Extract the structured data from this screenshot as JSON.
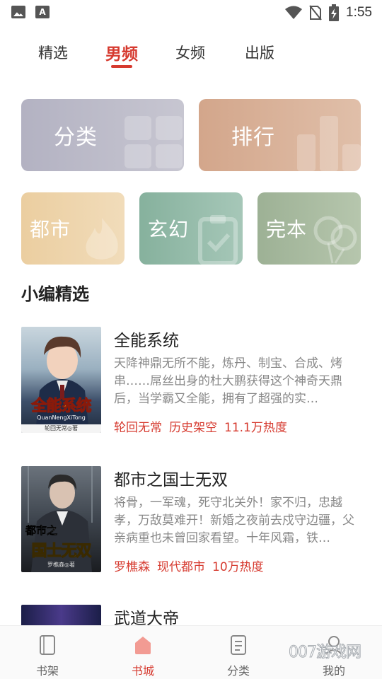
{
  "status_bar": {
    "time": "1:55",
    "icons": [
      "gallery-icon",
      "font-icon",
      "wifi-icon",
      "no-sim-icon",
      "battery-charging-icon"
    ]
  },
  "tabs": [
    {
      "label": "精选"
    },
    {
      "label": "男频",
      "active": true
    },
    {
      "label": "女频"
    },
    {
      "label": "出版"
    }
  ],
  "cards": {
    "category": {
      "label": "分类",
      "color": "#b9b8c6"
    },
    "ranking": {
      "label": "排行",
      "color": "#d7ad93"
    },
    "dushi": {
      "label": "都市",
      "color": "#ecd2a6"
    },
    "xuanhuan": {
      "label": "玄幻",
      "color": "#8cb6a3"
    },
    "wanben": {
      "label": "完本",
      "color": "#a3b69a"
    }
  },
  "section": {
    "title": "小编精选"
  },
  "books": [
    {
      "title": "全能系统",
      "desc": "天降神鼎无所不能，炼丹、制宝、合成、烤串……屌丝出身的杜大鹏获得这个神奇天鼎后，当学霸又全能，拥有了超强的实…",
      "author": "轮回无常",
      "genre": "历史架空",
      "heat": "11.1万热度",
      "cover_text": "全能系统",
      "cover_sub": "QuanNengXiTong",
      "cover_author": "轮回无常◎著"
    },
    {
      "title": "都市之国士无双",
      "desc": "将骨，一军魂，死守北关外！家不归，忠越孝，万敌莫难开！新婚之夜前去戍守边疆，父亲病重也未曾回家看望。十年风霜，铁…",
      "author": "罗樵森",
      "genre": "现代都市",
      "heat": "10万热度",
      "cover_text1": "都市之",
      "cover_text2": "国士无双",
      "cover_author": "罗樵森◎著"
    },
    {
      "title": "武道大帝"
    }
  ],
  "bottom_nav": [
    {
      "label": "书架",
      "icon": "bookshelf-icon"
    },
    {
      "label": "书城",
      "icon": "bookstore-icon",
      "active": true
    },
    {
      "label": "分类",
      "icon": "category-list-icon"
    },
    {
      "label": "我的",
      "icon": "profile-icon"
    }
  ],
  "watermark": "007游戏网"
}
